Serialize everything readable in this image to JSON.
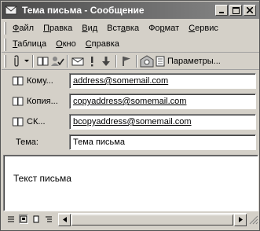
{
  "window": {
    "title": "Тема письма - Сообщение"
  },
  "menu": {
    "row1": [
      {
        "pre": "",
        "key": "Ф",
        "post": "айл"
      },
      {
        "pre": "",
        "key": "П",
        "post": "равка"
      },
      {
        "pre": "",
        "key": "В",
        "post": "ид"
      },
      {
        "pre": "Вст",
        "key": "а",
        "post": "вка"
      },
      {
        "pre": "Фо",
        "key": "р",
        "post": "мат"
      },
      {
        "pre": "",
        "key": "С",
        "post": "ервис"
      }
    ],
    "row2": [
      {
        "pre": "",
        "key": "Т",
        "post": "аблица"
      },
      {
        "pre": "",
        "key": "О",
        "post": "кно"
      },
      {
        "pre": "",
        "key": "С",
        "post": "правка"
      }
    ]
  },
  "toolbar": {
    "params_label": "Параметры..."
  },
  "fields": {
    "to_label": "Кому...",
    "to_value": "address@somemail.com",
    "cc_label": "Копия...",
    "cc_value": "copyaddress@somemail.com",
    "bcc_label": "СК...",
    "bcc_value": "bcopyaddress@somemail.com",
    "subject_label": "Тема:",
    "subject_value": "Тема письма"
  },
  "body": {
    "text": "Текст письма"
  }
}
